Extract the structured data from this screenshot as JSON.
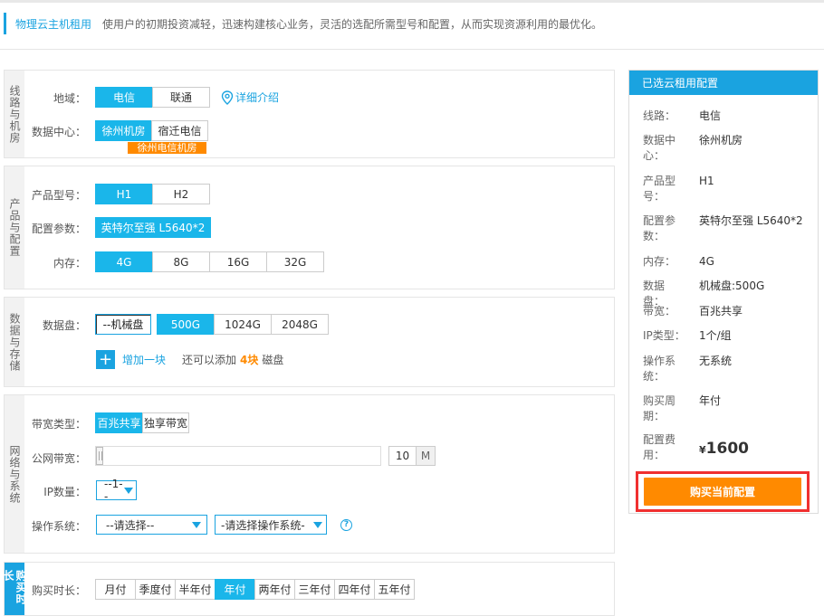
{
  "header": {
    "title": "物理云主机租用",
    "desc": "使用户的初期投资减轻，迅速构建核心业务，灵活的选配所需型号和配置，从而实现资源利用的最优化。"
  },
  "sec_line": {
    "side": "线路与机房",
    "region_label": "地域：",
    "region_options": [
      "电信",
      "联通"
    ],
    "detail_link": "详细介绍",
    "dc_label": "数据中心：",
    "dc_options": [
      "徐州机房",
      "宿迁电信"
    ],
    "dc_badge": "徐州电信机房"
  },
  "sec_product": {
    "side": "产品与配置",
    "model_label": "产品型号：",
    "model_options": [
      "H1",
      "H2"
    ],
    "spec_label": "配置参数：",
    "spec_value": "英特尔至强 L5640*2",
    "mem_label": "内存：",
    "mem_options": [
      "4G",
      "8G",
      "16G",
      "32G"
    ]
  },
  "sec_storage": {
    "side": "数据与存储",
    "disk_label": "数据盘：",
    "disk_type": "--机械盘",
    "disk_options": [
      "500G",
      "1024G",
      "2048G"
    ],
    "add_label": "增加一块",
    "hint_pre": "还可以添加",
    "hint_count": "4块",
    "hint_post": "磁盘"
  },
  "sec_network": {
    "side": "网络与系统",
    "bw_type_label": "带宽类型：",
    "bw_type_options": [
      "百兆共享",
      "独享带宽"
    ],
    "public_bw_label": "公网带宽：",
    "bw_value": "10",
    "bw_unit": "M",
    "ip_label": "IP数量：",
    "ip_value": "--1--",
    "os_label": "操作系统：",
    "os_select1": "--请选择--",
    "os_select2": "-请选择操作系统-",
    "help": "?"
  },
  "sec_period": {
    "side": "购买时长",
    "label": "购买时长：",
    "options": [
      "月付",
      "季度付",
      "半年付",
      "年付",
      "两年付",
      "三年付",
      "四年付",
      "五年付"
    ]
  },
  "summary": {
    "title": "已选云租用配置",
    "rows": [
      {
        "k": "线路：",
        "v": "电信"
      },
      {
        "k": "数据中心：",
        "v": "徐州机房"
      },
      {
        "k": "产品型号：",
        "v": "H1"
      },
      {
        "k": "配置参数：",
        "v": "英特尔至强 L5640*2"
      },
      {
        "k": "内存：",
        "v": "4G"
      },
      {
        "k": "数据盘：",
        "v": "机械盘:500G"
      },
      {
        "k": "带宽：",
        "v": "百兆共享"
      },
      {
        "k": "IP类型：",
        "v": "1个/组"
      },
      {
        "k": "操作系统：",
        "v": "无系统"
      },
      {
        "k": "购买周期：",
        "v": "年付"
      }
    ],
    "fee_label": "配置费用：",
    "currency": "¥",
    "price": "1600",
    "buy_button": "购买当前配置"
  },
  "colors": {
    "accent": "#1aa3e0",
    "selected": "#1ab6ea",
    "orange": "#ff8a00",
    "highlight_border": "#f03030"
  }
}
